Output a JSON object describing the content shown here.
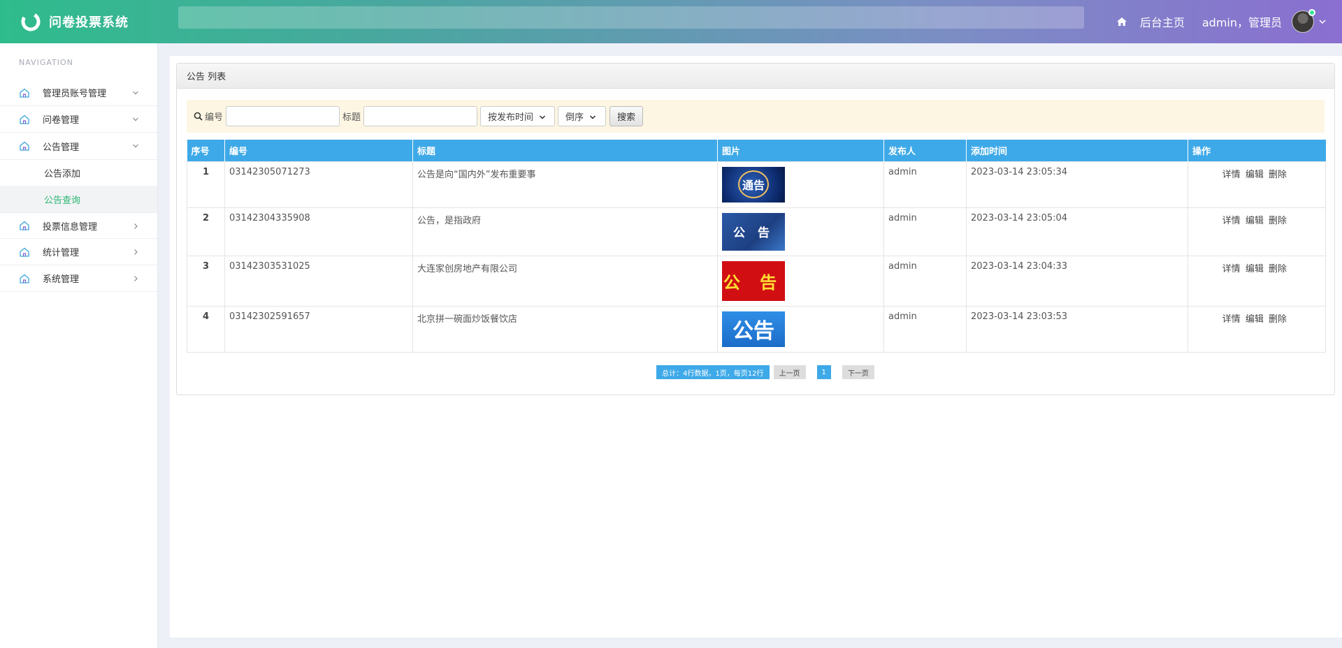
{
  "header": {
    "app_title": "问卷投票系统",
    "home_link": "后台主页",
    "user_label": "admin，管理员"
  },
  "sidebar": {
    "nav_label": "NAVIGATION",
    "items": [
      {
        "label": "管理员账号管理",
        "chevron": "down"
      },
      {
        "label": "问卷管理",
        "chevron": "down"
      },
      {
        "label": "公告管理",
        "chevron": "down"
      },
      {
        "label": "投票信息管理",
        "chevron": "right"
      },
      {
        "label": "统计管理",
        "chevron": "right"
      },
      {
        "label": "系统管理",
        "chevron": "right"
      }
    ],
    "sub_items": [
      {
        "label": "公告添加"
      },
      {
        "label": "公告查询",
        "active": true
      }
    ]
  },
  "panel": {
    "title": "公告 列表"
  },
  "filter": {
    "code_label": "编号",
    "title_label": "标题",
    "sort_field": "按发布时间",
    "sort_order": "倒序",
    "search_button": "搜索"
  },
  "table": {
    "columns": [
      "序号",
      "编号",
      "标题",
      "图片",
      "发布人",
      "添加时间",
      "操作"
    ],
    "rows": [
      {
        "idx": "1",
        "code": "03142305071273",
        "title": "公告是向“国内外”发布重要事",
        "image_text": "通告",
        "publisher": "admin",
        "time": "2023-03-14 23:05:34"
      },
      {
        "idx": "2",
        "code": "03142304335908",
        "title": "公告，是指政府",
        "image_text": "公 告",
        "publisher": "admin",
        "time": "2023-03-14 23:05:04"
      },
      {
        "idx": "3",
        "code": "03142303531025",
        "title": "大连家创房地产有限公司",
        "image_text": "公 告",
        "publisher": "admin",
        "time": "2023-03-14 23:04:33"
      },
      {
        "idx": "4",
        "code": "03142302591657",
        "title": "北京拼一碗面炒饭餐饮店",
        "image_text": "公告",
        "publisher": "admin",
        "time": "2023-03-14 23:03:53"
      }
    ],
    "ops": {
      "detail": "详情",
      "edit": "编辑",
      "delete": "删除"
    }
  },
  "pager": {
    "info": "总计：4行数据，1页，每页12行",
    "prev": "上一页",
    "current": "1",
    "next": "下一页"
  },
  "colors": {
    "accent": "#3ea9e8",
    "active_nav": "#2bb673",
    "filter_bg": "#fdf6e3"
  }
}
